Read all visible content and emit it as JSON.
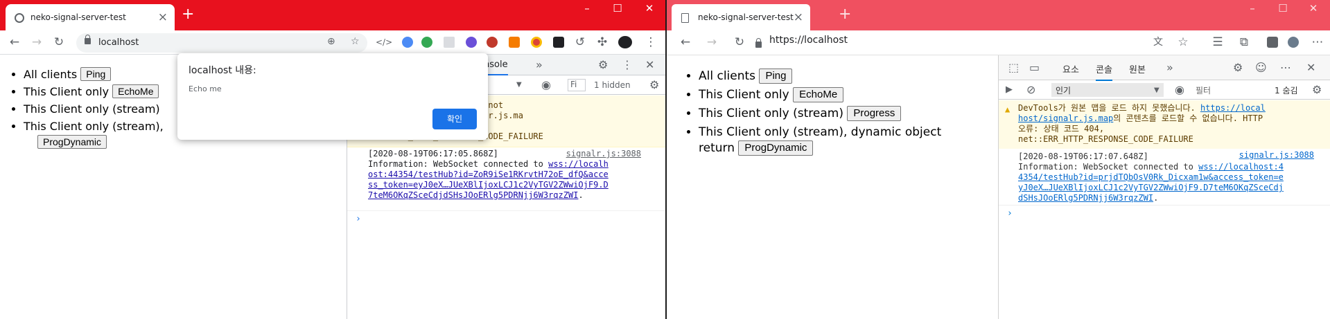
{
  "chrome": {
    "tab_title": "neko-signal-server-test",
    "url": "localhost",
    "page": {
      "items": [
        {
          "text": "All clients",
          "button": "Ping"
        },
        {
          "text": "This Client only",
          "button": "EchoMe"
        },
        {
          "text": "This Client only (stream)",
          "button": ""
        },
        {
          "text": "This Client only (stream),",
          "button": "ProgDynamic"
        }
      ]
    },
    "dialog": {
      "title": "localhost 내용:",
      "message": "Echo me",
      "ok_label": "확인"
    },
    "devtools": {
      "tab_console": "Console",
      "filter_placeholder": "Fi",
      "hidden_count": "1 hidden",
      "warning_text": "    ad SourceMap: Could not\n    s://localhost/signalr.js.ma\n    code 404,\nnet::ERR_HTTP_RESPONSE_CODE_FAILURE",
      "info_timestamp": "[2020-08-19T06:17:05.868Z]",
      "info_source": "signalr.js:3088",
      "info_text": "Information: WebSocket connected to ",
      "info_link": "wss://localh\nost:44354/testHub?id=ZoR9iSe1RKrvtH72oE_dfQ&acce\nss_token=eyJ0eX…JUeXBlIjoxLCJ1c2VyTGV2ZWwiOjF9.D\n7teM6OKqZSceCdjdSHsJOoERlg5PDRNjj6W3rqzZWI",
      "info_end": "."
    }
  },
  "edge": {
    "tab_title": "neko-signal-server-test",
    "url": "https://localhost",
    "page": {
      "items": [
        {
          "text": "All clients",
          "button": "Ping"
        },
        {
          "text": "This Client only",
          "button": "EchoMe"
        },
        {
          "text": "This Client only (stream)",
          "button": "Progress"
        },
        {
          "text": "This Client only (stream), dynamic object return",
          "button": "ProgDynamic"
        }
      ]
    },
    "devtools": {
      "tabs": [
        "요소",
        "콘솔",
        "원본"
      ],
      "level_select": "인기",
      "filter_placeholder": "필터",
      "hidden_count": "1 숨김",
      "warning_pre": "DevTools가 원본 맵을 로드 하지 못했습니다. ",
      "warning_link": "https://local\nhost/signalr.js.map",
      "warning_post": "의 콘텐츠를 로드할 수 없습니다. HTTP\n오류: 상태 코드 404,\nnet::ERR_HTTP_RESPONSE_CODE_FAILURE",
      "info_timestamp": "[2020-08-19T06:17:07.648Z]",
      "info_source": "signalr.js:3088",
      "info_text": "Information: WebSocket connected to ",
      "info_link": "wss://localhost:4\n4354/testHub?id=prjdTQbOsV0Rk_Dicxam1w&access_token=e\nyJ0eX…JUeXBlIjoxLCJ1c2VyTGV2ZWwiOjF9.D7teM6OKqZSceCdj\ndSHsJOoERlg5PDRNjj6W3rqzZWI",
      "info_end": "."
    }
  },
  "colors": {
    "chrome_frame": "#e8111e",
    "edge_frame": "#f05060",
    "accent": "#1a73e8"
  }
}
